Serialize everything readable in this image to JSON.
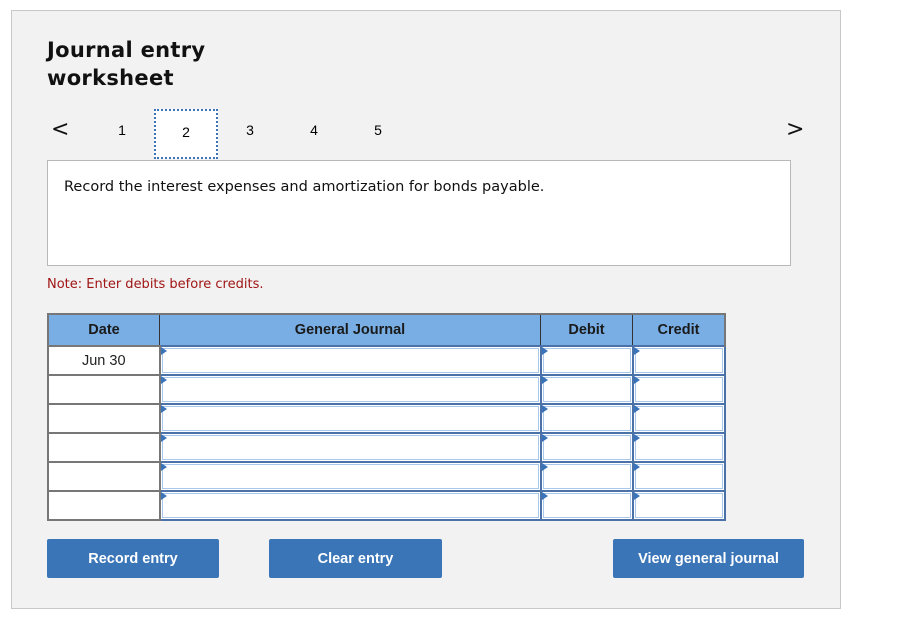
{
  "worksheet": {
    "title_line1": "Journal entry",
    "title_line2": "worksheet"
  },
  "navigation": {
    "prev_icon": "chevron-left-icon",
    "next_icon": "chevron-right-icon",
    "prev_glyph": "<",
    "next_glyph": ">",
    "tabs": [
      {
        "label": "1",
        "active": false
      },
      {
        "label": "2",
        "active": true
      },
      {
        "label": "3",
        "active": false
      },
      {
        "label": "4",
        "active": false
      },
      {
        "label": "5",
        "active": false
      }
    ]
  },
  "instruction": "Record the interest expenses and amortization for bonds payable.",
  "note": "Note: Enter debits before credits.",
  "journal_table": {
    "columns": [
      "Date",
      "General Journal",
      "Debit",
      "Credit"
    ],
    "rows": [
      {
        "date": "Jun 30",
        "account": "",
        "debit": "",
        "credit": ""
      },
      {
        "date": "",
        "account": "",
        "debit": "",
        "credit": ""
      },
      {
        "date": "",
        "account": "",
        "debit": "",
        "credit": ""
      },
      {
        "date": "",
        "account": "",
        "debit": "",
        "credit": ""
      },
      {
        "date": "",
        "account": "",
        "debit": "",
        "credit": ""
      },
      {
        "date": "",
        "account": "",
        "debit": "",
        "credit": ""
      }
    ]
  },
  "buttons": {
    "record": "Record entry",
    "clear": "Clear entry",
    "view": "View general journal"
  },
  "colors": {
    "accent": "#3a75b8",
    "header_bg": "#78aee4",
    "note_text": "#a01515",
    "panel_bg": "#f2f2f2"
  }
}
